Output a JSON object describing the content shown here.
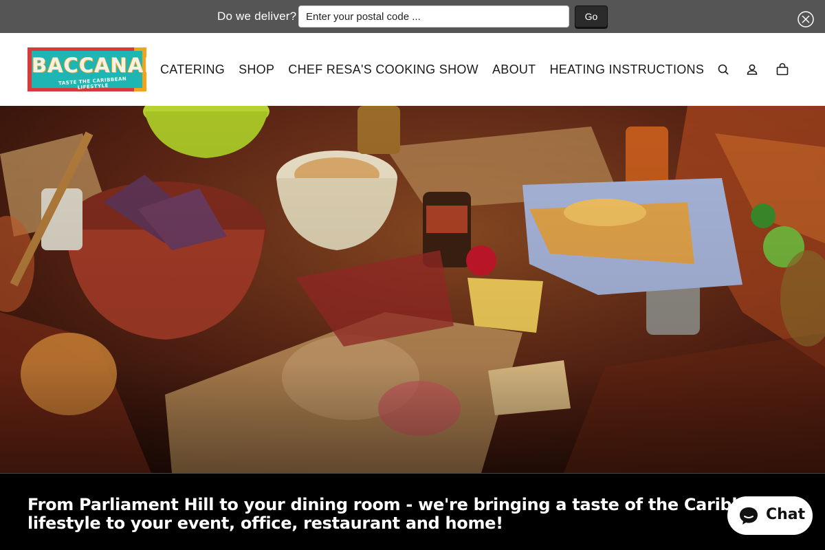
{
  "delivery_bar": {
    "label": "Do we deliver?",
    "postal_placeholder": "Enter your postal code ...",
    "go_label": "Go",
    "close_icon": "close-circle-icon"
  },
  "header": {
    "logo": {
      "word": "BACCANALLE",
      "tagline": "TASTE THE CARIBBEAN LIFESTYLE"
    },
    "nav": [
      {
        "label": "CATERING"
      },
      {
        "label": "SHOP"
      },
      {
        "label": "CHEF RESA'S COOKING SHOW"
      },
      {
        "label": "ABOUT"
      },
      {
        "label": "HEATING INSTRUCTIONS"
      }
    ],
    "icons": [
      "search-icon",
      "account-icon",
      "cart-icon"
    ]
  },
  "hero": {
    "image": "caribbean-food-spread-photo"
  },
  "tagline": {
    "text": "From Parliament Hill to your dining room - we're bringing a taste of the Caribbean lifestyle to your event, office, restaurant and home!"
  },
  "chat": {
    "label": "Chat",
    "icon": "chat-bubble-icon"
  },
  "colors": {
    "delivery_bar": "#555555",
    "logo_red": "#d63b3b",
    "logo_teal": "#1fb5b2",
    "logo_orange": "#f0a31b",
    "tagline_bg": "#000000"
  }
}
